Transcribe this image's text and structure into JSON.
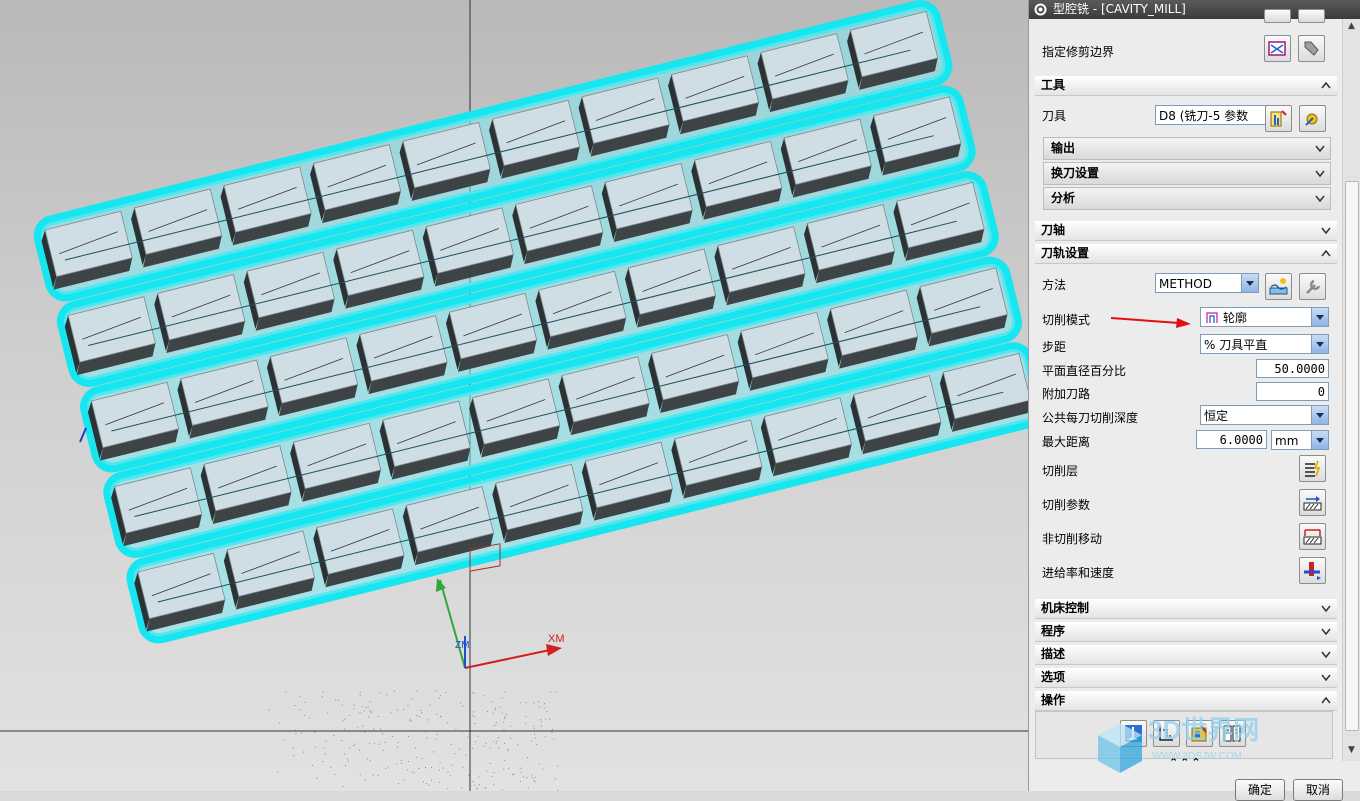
{
  "window": {
    "title": "型腔铣 - [CAVITY_MILL]"
  },
  "trim_boundary": {
    "label": "指定修剪边界"
  },
  "tool_section": {
    "title": "工具",
    "tool_label": "刀具",
    "tool_value": "D8 (铣刀-5 参数",
    "subsections": [
      {
        "label": "输出"
      },
      {
        "label": "换刀设置"
      },
      {
        "label": "分析"
      }
    ]
  },
  "axis_section": {
    "title": "刀轴"
  },
  "path_section": {
    "title": "刀轨设置",
    "method_label": "方法",
    "method_value": "METHOD",
    "cut_pattern_label": "切削模式",
    "cut_pattern_value": "轮廓",
    "stepover_label": "步距",
    "stepover_value": "% 刀具平直",
    "flat_diameter_label": "平面直径百分比",
    "flat_diameter_value": "50.0000",
    "additional_passes_label": "附加刀路",
    "additional_passes_value": "0",
    "depth_per_cut_label": "公共每刀切削深度",
    "depth_per_cut_value": "恒定",
    "max_distance_label": "最大距离",
    "max_distance_value": "6.0000",
    "max_distance_unit": "mm",
    "cut_levels_label": "切削层",
    "cut_params_label": "切削参数",
    "non_cutting_label": "非切削移动",
    "feeds_label": "进给率和速度"
  },
  "collapsed_sections": [
    {
      "title": "机床控制"
    },
    {
      "title": "程序"
    },
    {
      "title": "描述"
    },
    {
      "title": "选项"
    }
  ],
  "operation_section": {
    "title": "操作",
    "expand_symbol": "⌃⌃⌃"
  },
  "buttons": {
    "ok": "确定",
    "cancel": "取消"
  },
  "viewport": {
    "axis_x_label": "XM",
    "axis_z_label": "ZM"
  },
  "watermark": {
    "text": "3D世界网",
    "sub": "WWW.3DSJW.COM"
  },
  "colors": {
    "toolpath_glow": "#16e6f0",
    "block_top": "#cfdde4",
    "block_side": "#3e4446",
    "annotation_arrow": "#e01010"
  }
}
